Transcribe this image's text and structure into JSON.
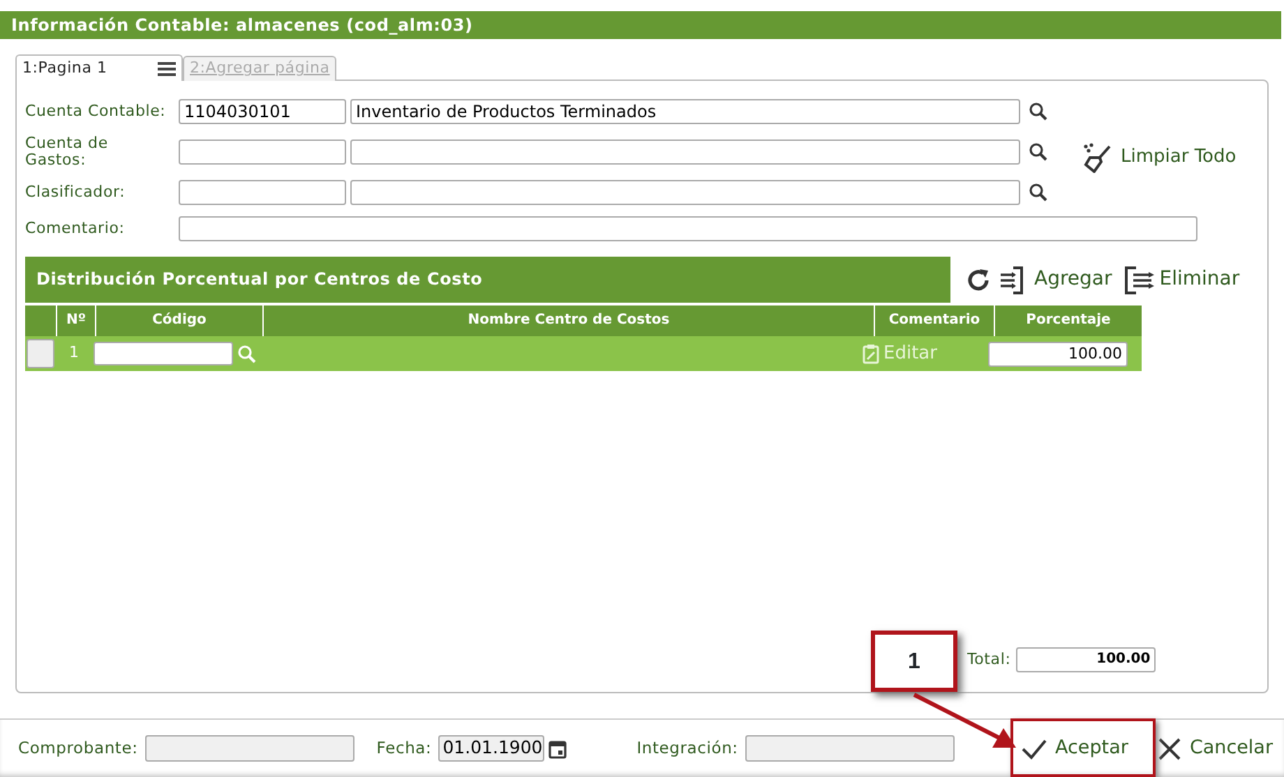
{
  "window": {
    "title": "Información Contable: almacenes (cod_alm:03)"
  },
  "tabs": [
    {
      "label": "1:Pagina 1",
      "selected": true
    },
    {
      "label": "2:Agregar página",
      "selected": false
    }
  ],
  "account_fields": [
    {
      "label": "Cuenta Contable:",
      "code": "1104030101",
      "description": "Inventario de Productos Terminados"
    },
    {
      "label": "Cuenta de Gastos:"
    },
    {
      "label": "Clasificador:"
    }
  ],
  "comment_field": {
    "label": "Comentario:"
  },
  "clear_button": {
    "label": "Limpiar Todo"
  },
  "cost_centers": {
    "title": "Distribución Porcentual por Centros de Costo",
    "add_button": {
      "label": "Agregar"
    },
    "remove_button": {
      "label": "Eliminar"
    },
    "columns": [
      "Nº",
      "Código",
      "Nombre Centro de Costos",
      "Comentario",
      "Porcentaje"
    ],
    "rows": [
      {
        "checked": false,
        "number": "1",
        "comment_action": "Editar",
        "percentage": "100.00"
      }
    ],
    "total": {
      "label": "Total:",
      "value": "100.00"
    }
  },
  "footer_fields": [
    {
      "kind": "text",
      "label": "Comprobante:"
    },
    {
      "kind": "date",
      "label": "Fecha:",
      "value": "01.01.1900"
    },
    {
      "kind": "text",
      "label": "Integración:"
    }
  ],
  "buttons": [
    {
      "kind": "accept",
      "label": "Aceptar"
    },
    {
      "kind": "cancel",
      "label": "Cancelar"
    }
  ],
  "callout": {
    "label": "1"
  }
}
